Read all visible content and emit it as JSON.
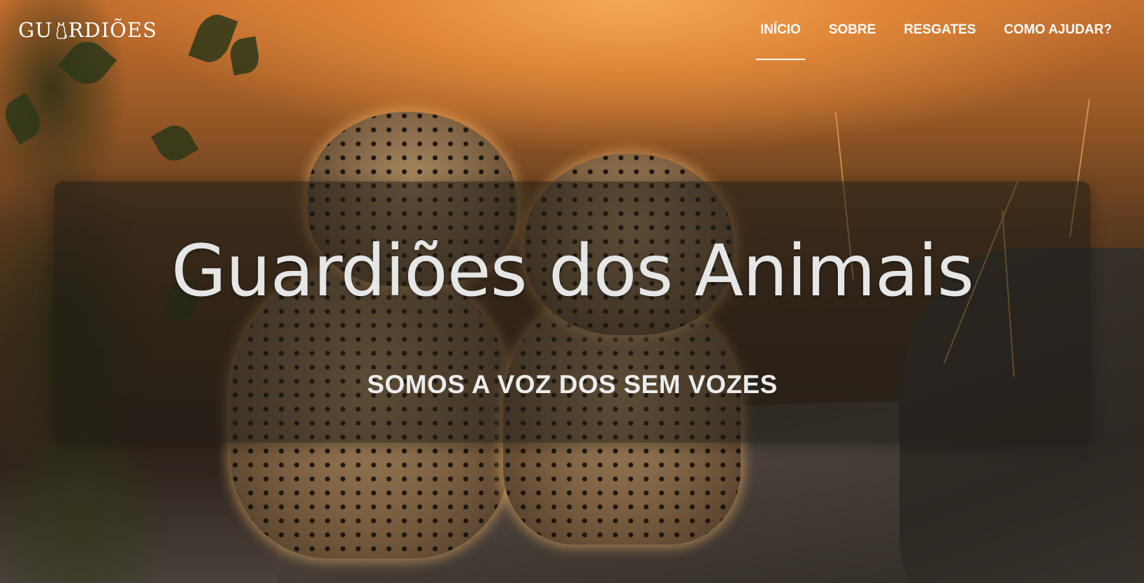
{
  "brand": {
    "logo_text_left": "GU",
    "logo_text_right": "RDIÕES"
  },
  "nav": {
    "items": [
      {
        "label": "INÍCIO",
        "active": true
      },
      {
        "label": "SOBRE",
        "active": false
      },
      {
        "label": "RESGATES",
        "active": false
      },
      {
        "label": "COMO AJUDAR?",
        "active": false
      }
    ]
  },
  "hero": {
    "title": "Guardiões dos Animais",
    "subtitle": "SOMOS A VOZ DOS SEM VOZES",
    "background_image": "two-leopard-cubs-at-sunset"
  },
  "colors": {
    "text": "#ffffff",
    "card_overlay": "rgba(30,28,22,0.55)",
    "sunset_accent": "#f6a955"
  }
}
